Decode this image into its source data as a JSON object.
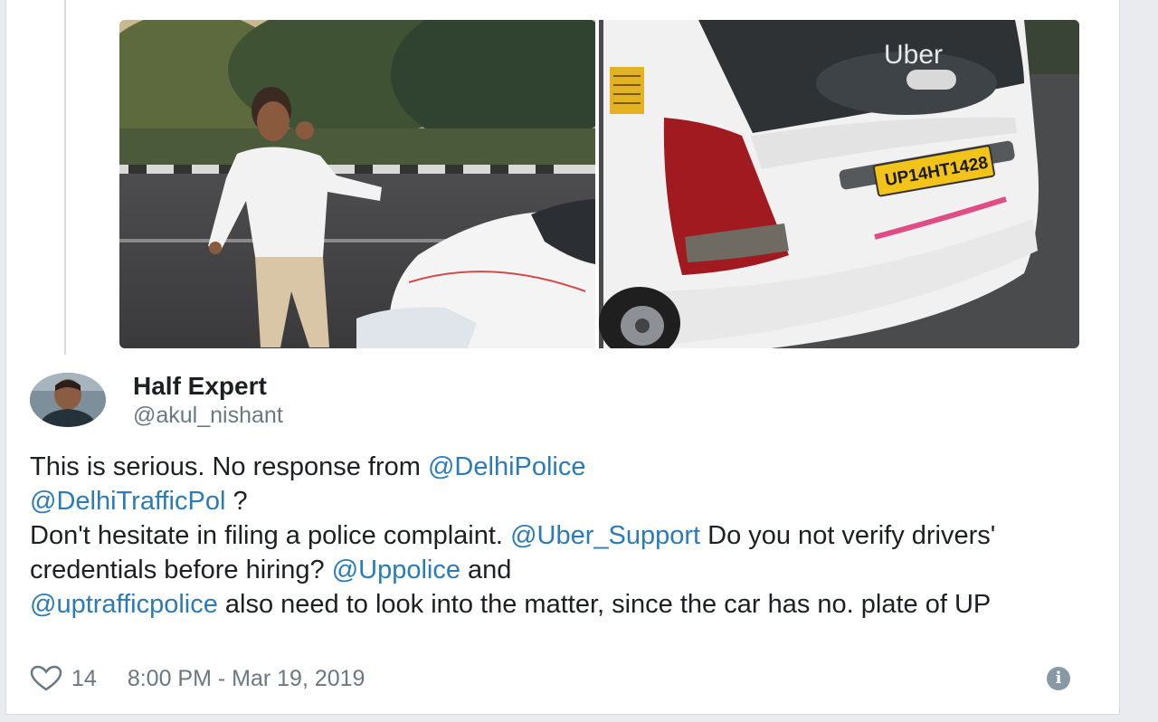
{
  "tweet": {
    "display_name": "Half Expert",
    "handle": "@akul_nishant",
    "text": {
      "line1_a": "This is serious. No response from ",
      "mention1": "@DelhiPolice",
      "mention2": "@DelhiTrafficPol",
      "line2_b": " ?",
      "line3_a": "Don't hesitate in filing a police complaint. ",
      "mention3": "@Uber_Support",
      "line3_b": " Do you not verify drivers' credentials before hiring? ",
      "mention4": "@Uppolice",
      "line4_b": " and ",
      "mention5": "@uptrafficpolice",
      "line5_b": " also need to look into the matter, since the car has no. plate of UP"
    },
    "likes": "14",
    "timestamp": "8:00 PM - Mar 19, 2019"
  },
  "media": {
    "plate_text": "UP14HT1428",
    "car_badge": "Uber"
  },
  "icons": {
    "like": "heart-icon",
    "info": "info-icon"
  },
  "colors": {
    "mention": "#2b7bb9",
    "text": "#1c2022",
    "meta": "#697882"
  }
}
